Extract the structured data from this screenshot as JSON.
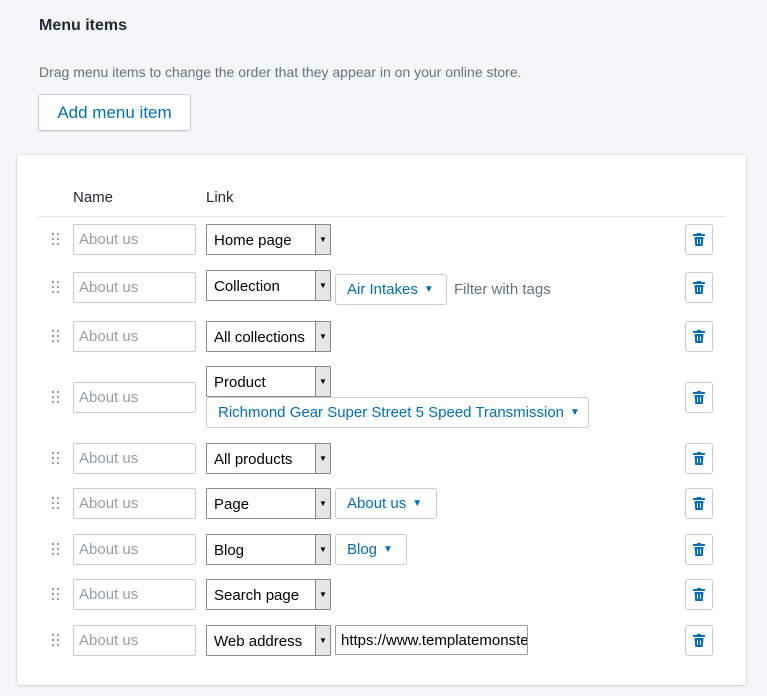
{
  "section": {
    "title": "Menu items",
    "description": "Drag menu items to change the order that they appear in on your online store.",
    "add_button": "Add menu item"
  },
  "table": {
    "col_name": "Name",
    "col_link": "Link"
  },
  "name_placeholder": "About us",
  "rows": [
    {
      "link_type": "Home page"
    },
    {
      "link_type": "Collection",
      "target": "Air Intakes",
      "filter": "Filter with tags"
    },
    {
      "link_type": "All collections"
    },
    {
      "link_type": "Product",
      "target": "Richmond Gear Super Street 5 Speed Transmission"
    },
    {
      "link_type": "All products"
    },
    {
      "link_type": "Page",
      "target": "About us"
    },
    {
      "link_type": "Blog",
      "target": "Blog"
    },
    {
      "link_type": "Search page"
    },
    {
      "link_type": "Web address",
      "url": "https://www.templatemonster.com"
    }
  ],
  "colors": {
    "accent": "#006fbb",
    "background": "#f4f6f8",
    "delete_icon": "#006fbb"
  },
  "icons": {
    "drag": "drag-handle-icon",
    "delete": "trash-icon",
    "caret": "caret-down-icon"
  }
}
